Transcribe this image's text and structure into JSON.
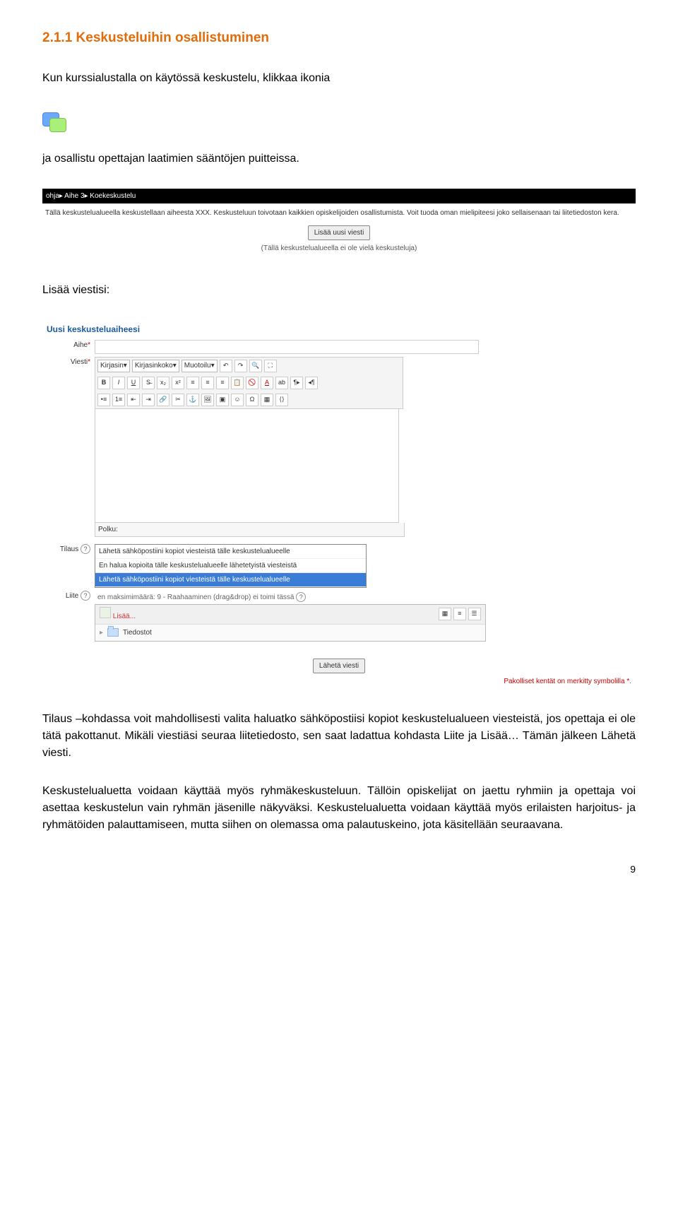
{
  "heading": "2.1.1 Keskusteluihin osallistuminen",
  "intro1": "Kun kurssialustalla on käytössä keskustelu, klikkaa ikonia",
  "intro2": "ja osallistu opettajan laatimien sääntöjen puitteissa.",
  "screenshot1": {
    "breadcrumb": "ohja▸ Aihe 3▸ Koekeskustelu",
    "description": "Tällä keskustelualueella keskustellaan aiheesta XXX. Keskusteluun toivotaan kaikkien opiskelijoiden osallistumista. Voit tuoda oman mielipiteesi joko sellaisenaan tai liitetiedoston kera.",
    "button": "Lisää uusi viesti",
    "note": "(Tällä keskustelualueella ei ole vielä keskusteluja)"
  },
  "caption1": "Lisää viestisi:",
  "screenshot2": {
    "legend": "Uusi keskusteluaiheesi",
    "labels": {
      "aihe": "Aihe",
      "viesti": "Viesti",
      "tilaus": "Tilaus",
      "liite": "Liite"
    },
    "toolbar": {
      "font": "Kirjasin",
      "size": "Kirjasinkoko",
      "format": "Muotoilu"
    },
    "path_label": "Polku:",
    "dropdown_options": [
      "Lähetä sähköpostiini kopiot viesteistä tälle keskustelualueelle",
      "En halua kopioita tälle keskustelualueelle lähetetyistä viesteistä",
      "Lähetä sähköpostiini kopiot viesteistä tälle keskustelualueelle"
    ],
    "attach_hint": "en maksimimäärä: 9 - Raahaaminen (drag&drop) ei toimi tässä",
    "add": "Lisää...",
    "folder": "Tiedostot",
    "submit": "Lähetä viesti",
    "required_note": "Pakolliset kentät on merkitty symbolilla *."
  },
  "p1": "Tilaus –kohdassa voit mahdollisesti valita haluatko sähköpostiisi kopiot keskustelualueen viesteistä, jos opettaja ei ole tätä pakottanut. Mikäli viestiäsi seuraa liitetiedosto, sen saat ladattua kohdasta Liite ja Lisää… Tämän jälkeen Lähetä viesti.",
  "p2": "Keskustelualuetta voidaan käyttää myös ryhmäkeskusteluun. Tällöin opiskelijat on jaettu ryhmiin ja opettaja voi asettaa keskustelun vain ryhmän jäsenille näkyväksi. Keskustelualuetta voidaan käyttää myös erilaisten harjoitus- ja ryhmätöiden palauttamiseen, mutta siihen on olemassa oma palautuskeino, jota käsitellään seuraavana.",
  "pagenum": "9"
}
